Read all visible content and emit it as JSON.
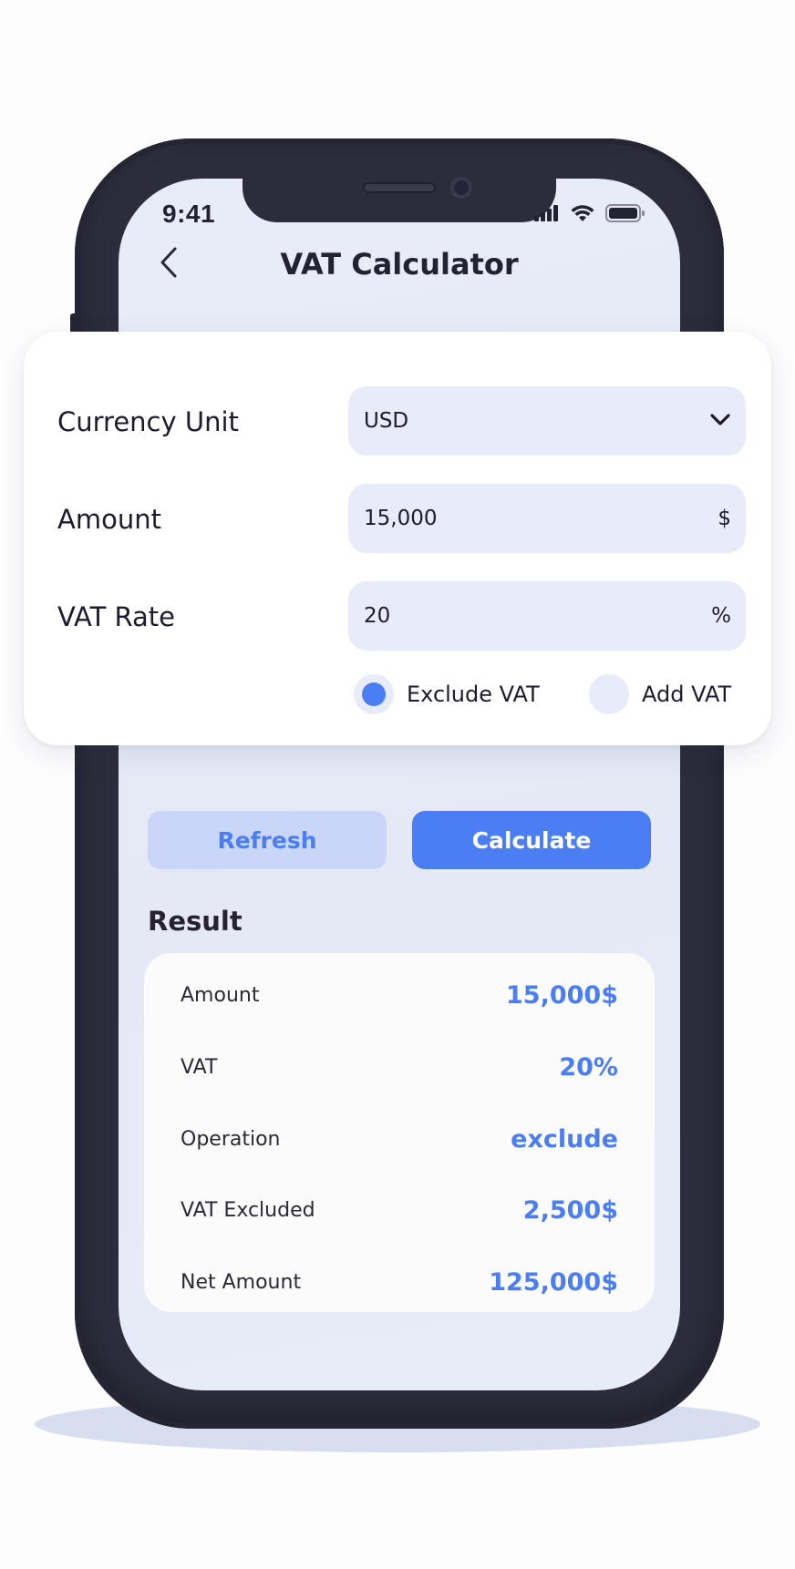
{
  "status_bar": {
    "time": "9:41"
  },
  "nav": {
    "back_icon": "chevron-left-icon",
    "title": "VAT Calculator"
  },
  "form": {
    "currency": {
      "label": "Currency Unit",
      "value": "USD",
      "icon": "chevron-down-icon"
    },
    "amount": {
      "label": "Amount",
      "value": "15,000",
      "suffix": "$"
    },
    "vat_rate": {
      "label": "VAT Rate",
      "value": "20",
      "suffix": "%"
    },
    "options": [
      {
        "label": "Exclude VAT",
        "selected": true
      },
      {
        "label": "Add VAT",
        "selected": false
      }
    ]
  },
  "actions": {
    "refresh_label": "Refresh",
    "calculate_label": "Calculate"
  },
  "result": {
    "title": "Result",
    "rows": [
      {
        "key": "Amount",
        "value": "15,000$"
      },
      {
        "key": "VAT",
        "value": "20%"
      },
      {
        "key": "Operation",
        "value": "exclude"
      },
      {
        "key": "VAT Excluded",
        "value": "2,500$"
      },
      {
        "key": "Net Amount",
        "value": "125,000$"
      }
    ]
  },
  "colors": {
    "accent": "#4a7ef2",
    "accent_light": "#c9d6f7",
    "field_bg": "#e8ebfa",
    "phone_frame": "#2d2c3c",
    "text_dark": "#1f1a2e"
  }
}
